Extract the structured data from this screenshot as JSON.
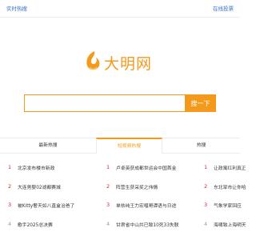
{
  "header": {
    "left_link": "实时热搜",
    "right_link": "在线投票"
  },
  "logo": {
    "brand_text": "大明网",
    "accent_color": "#f39a1d"
  },
  "search": {
    "value": "",
    "button_label": "搜一下"
  },
  "tabs": [
    {
      "label": "最新热搜"
    },
    {
      "label": "短视频热搜"
    },
    {
      "label": "热搜"
    }
  ],
  "columns": [
    {
      "items": [
        {
          "rank": "1",
          "title": "北京发布楼市新政"
        },
        {
          "rank": "2",
          "title": "大连男婴02滤都赛城"
        },
        {
          "rank": "3",
          "title": "被Kitty奢天如八直盒治爸了"
        },
        {
          "rank": "4",
          "title": "歌手2025总决赛"
        }
      ]
    },
    {
      "items": [
        {
          "rank": "1",
          "title": "卢卓英获成都世运会中国首金"
        },
        {
          "rank": "2",
          "title": "阵营生获采奖之伟情"
        },
        {
          "rank": "3",
          "title": "单依纯王力宏唱哥谭语与日途"
        },
        {
          "rank": "4",
          "title": "甘肃省中山共已致10死33失联"
        }
      ]
    },
    {
      "items": [
        {
          "rank": "1",
          "title": "让政寓红利真正"
        },
        {
          "rank": "2",
          "title": "东北旱市让你哈"
        },
        {
          "rank": "3",
          "title": "气象学家回应"
        },
        {
          "rank": "4",
          "title": "海啸致上海明天"
        }
      ]
    }
  ]
}
